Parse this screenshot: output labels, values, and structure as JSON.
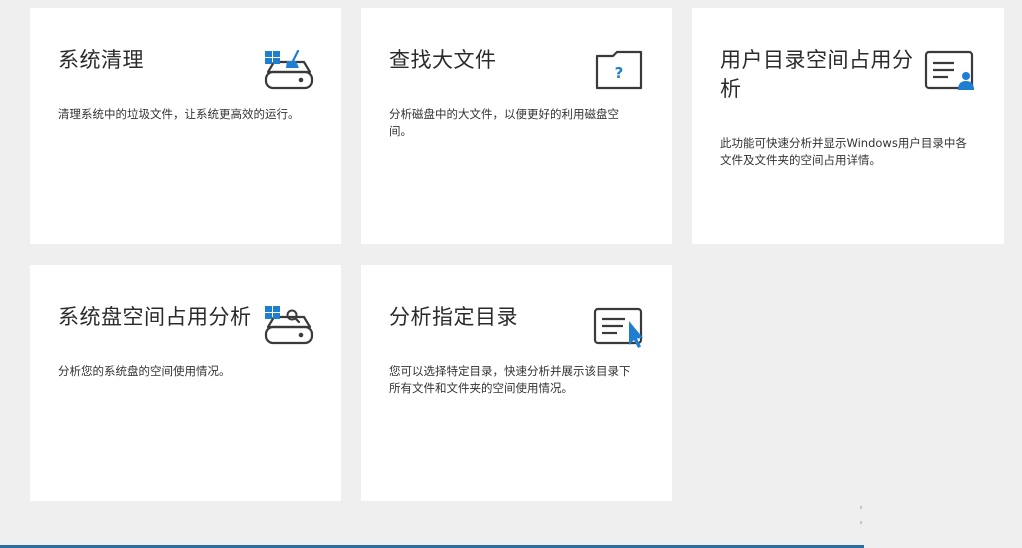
{
  "cards": [
    {
      "title": "系统清理",
      "description": "清理系统中的垃圾文件，让系统更高效的运行。",
      "icon": "disk-clean-icon"
    },
    {
      "title": "查找大文件",
      "description": "分析磁盘中的大文件，以便更好的利用磁盘空间。",
      "icon": "folder-question-icon"
    },
    {
      "title": "用户目录空间占用分析",
      "description": "此功能可快速分析并显示Windows用户目录中各文件及文件夹的空间占用详情。",
      "icon": "user-directory-icon"
    },
    {
      "title": "系统盘空间占用分析",
      "description": "分析您的系统盘的空间使用情况。",
      "icon": "disk-search-icon"
    },
    {
      "title": "分析指定目录",
      "description": "您可以选择特定目录，快速分析并展示该目录下所有文件和文件夹的空间使用情况。",
      "icon": "document-cursor-icon"
    }
  ],
  "colors": {
    "accent": "#1e7fd0",
    "icon_stroke": "#3a3a3a",
    "background": "#efefef",
    "card": "#ffffff",
    "bottom_bar": "#2a6f9e"
  }
}
